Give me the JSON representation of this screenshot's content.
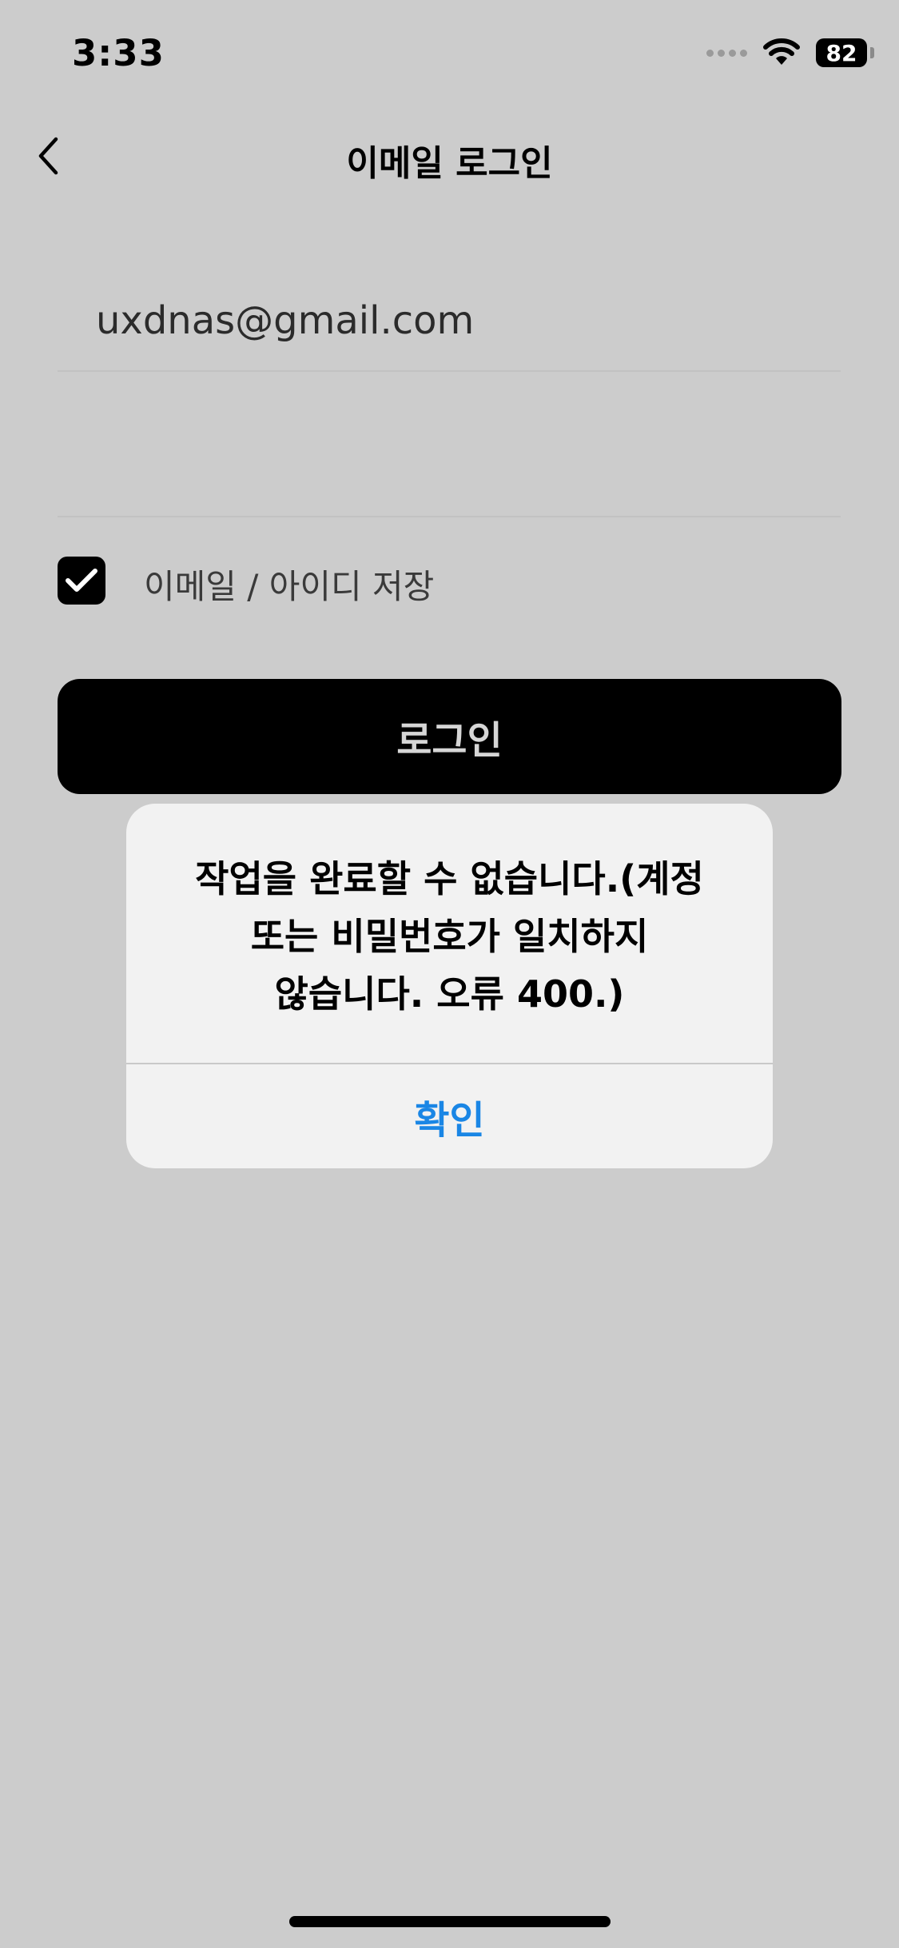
{
  "status_bar": {
    "time": "3:33",
    "battery": "82",
    "icons": [
      "cellular-signal-icon",
      "wifi-icon",
      "battery-icon"
    ]
  },
  "nav": {
    "back_icon": "chevron-left-icon",
    "title": "이메일 로그인"
  },
  "form": {
    "email_value": "uxdnas@gmail.com",
    "password_value": "",
    "save_checked": true,
    "save_label": "이메일 / 아이디 저장",
    "login_label": "로그인"
  },
  "alert": {
    "line1": "작업을 완료할 수 없습니다.(계정",
    "line2": "또는 비밀번호가 일치하지",
    "line3": "않습니다. 오류 400.)",
    "confirm_label": "확인"
  },
  "colors": {
    "background": "#cccccc",
    "button": "#000000",
    "alert_background": "#f2f2f2",
    "alert_action": "#1a86e5"
  }
}
